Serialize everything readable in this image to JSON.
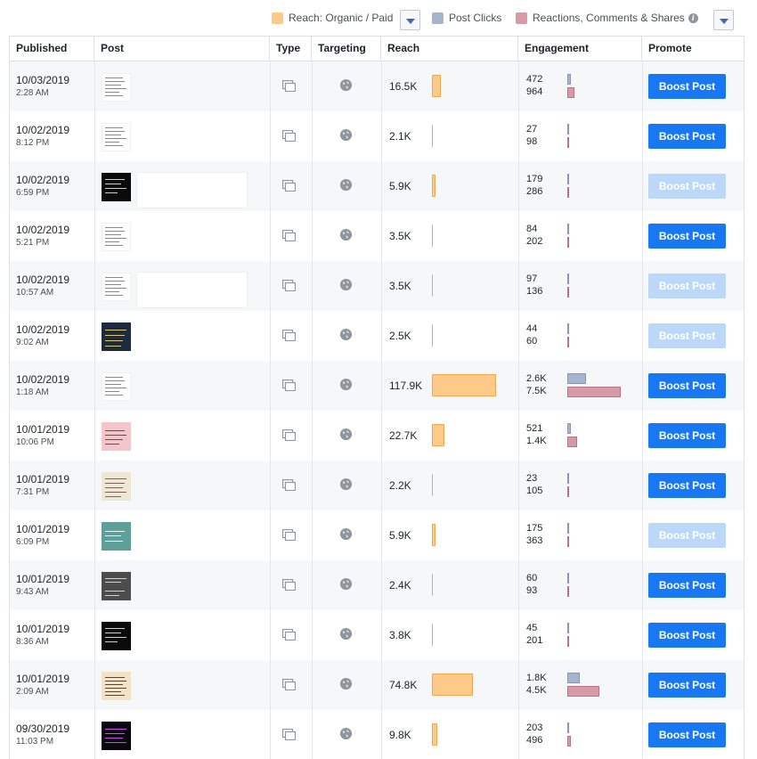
{
  "legend": {
    "reach_label": "Reach: Organic / Paid",
    "clicks_label": "Post Clicks",
    "reactions_label": "Reactions, Comments & Shares",
    "info_glyph": "i",
    "colors": {
      "reach": "#ffc98a",
      "clicks": "#a5b4cf",
      "reactions": "#d79aa8"
    }
  },
  "columns": [
    "Published",
    "Post",
    "Type",
    "Targeting",
    "Reach",
    "Engagement",
    "Promote"
  ],
  "boost_label": "Boost Post",
  "rows": [
    {
      "date": "10/03/2019",
      "time": "2:28 AM",
      "reach": "16.5K",
      "reach_n": 16.5,
      "clicks": "472",
      "reactions": "964",
      "clicks_n": 472,
      "reactions_n": 964,
      "boost_enabled": true,
      "thumb": "white",
      "preview": false
    },
    {
      "date": "10/02/2019",
      "time": "8:12 PM",
      "reach": "2.1K",
      "reach_n": 2.1,
      "clicks": "27",
      "reactions": "98",
      "clicks_n": 27,
      "reactions_n": 98,
      "boost_enabled": true,
      "thumb": "white",
      "preview": false
    },
    {
      "date": "10/02/2019",
      "time": "6:59 PM",
      "reach": "5.9K",
      "reach_n": 5.9,
      "clicks": "179",
      "reactions": "286",
      "clicks_n": 179,
      "reactions_n": 286,
      "boost_enabled": false,
      "thumb": "dark",
      "preview": true
    },
    {
      "date": "10/02/2019",
      "time": "5:21 PM",
      "reach": "3.5K",
      "reach_n": 3.5,
      "clicks": "84",
      "reactions": "202",
      "clicks_n": 84,
      "reactions_n": 202,
      "boost_enabled": true,
      "thumb": "white",
      "preview": false
    },
    {
      "date": "10/02/2019",
      "time": "10:57 AM",
      "reach": "3.5K",
      "reach_n": 3.5,
      "clicks": "97",
      "reactions": "136",
      "clicks_n": 97,
      "reactions_n": 136,
      "boost_enabled": false,
      "thumb": "white",
      "preview": true
    },
    {
      "date": "10/02/2019",
      "time": "9:02 AM",
      "reach": "2.5K",
      "reach_n": 2.5,
      "clicks": "44",
      "reactions": "60",
      "clicks_n": 44,
      "reactions_n": 60,
      "boost_enabled": false,
      "thumb": "navy",
      "preview": false
    },
    {
      "date": "10/02/2019",
      "time": "1:18 AM",
      "reach": "117.9K",
      "reach_n": 117.9,
      "clicks": "2.6K",
      "reactions": "7.5K",
      "clicks_n": 2600,
      "reactions_n": 7500,
      "boost_enabled": true,
      "thumb": "white",
      "preview": false
    },
    {
      "date": "10/01/2019",
      "time": "10:06 PM",
      "reach": "22.7K",
      "reach_n": 22.7,
      "clicks": "521",
      "reactions": "1.4K",
      "clicks_n": 521,
      "reactions_n": 1400,
      "boost_enabled": true,
      "thumb": "pink",
      "preview": false
    },
    {
      "date": "10/01/2019",
      "time": "7:31 PM",
      "reach": "2.2K",
      "reach_n": 2.2,
      "clicks": "23",
      "reactions": "105",
      "clicks_n": 23,
      "reactions_n": 105,
      "boost_enabled": true,
      "thumb": "cream",
      "preview": false
    },
    {
      "date": "10/01/2019",
      "time": "6:09 PM",
      "reach": "5.9K",
      "reach_n": 5.9,
      "clicks": "175",
      "reactions": "363",
      "clicks_n": 175,
      "reactions_n": 363,
      "boost_enabled": false,
      "thumb": "teal",
      "preview": false
    },
    {
      "date": "10/01/2019",
      "time": "9:43 AM",
      "reach": "2.4K",
      "reach_n": 2.4,
      "clicks": "60",
      "reactions": "93",
      "clicks_n": 60,
      "reactions_n": 93,
      "boost_enabled": true,
      "thumb": "gray",
      "preview": false
    },
    {
      "date": "10/01/2019",
      "time": "8:36 AM",
      "reach": "3.8K",
      "reach_n": 3.8,
      "clicks": "45",
      "reactions": "201",
      "clicks_n": 45,
      "reactions_n": 201,
      "boost_enabled": true,
      "thumb": "dark",
      "preview": false
    },
    {
      "date": "10/01/2019",
      "time": "2:09 AM",
      "reach": "74.8K",
      "reach_n": 74.8,
      "clicks": "1.8K",
      "reactions": "4.5K",
      "clicks_n": 1800,
      "reactions_n": 4500,
      "boost_enabled": true,
      "thumb": "parch",
      "preview": false
    },
    {
      "date": "09/30/2019",
      "time": "11:03 PM",
      "reach": "9.8K",
      "reach_n": 9.8,
      "clicks": "203",
      "reactions": "496",
      "clicks_n": 203,
      "reactions_n": 496,
      "boost_enabled": true,
      "thumb": "purple",
      "preview": false
    }
  ]
}
